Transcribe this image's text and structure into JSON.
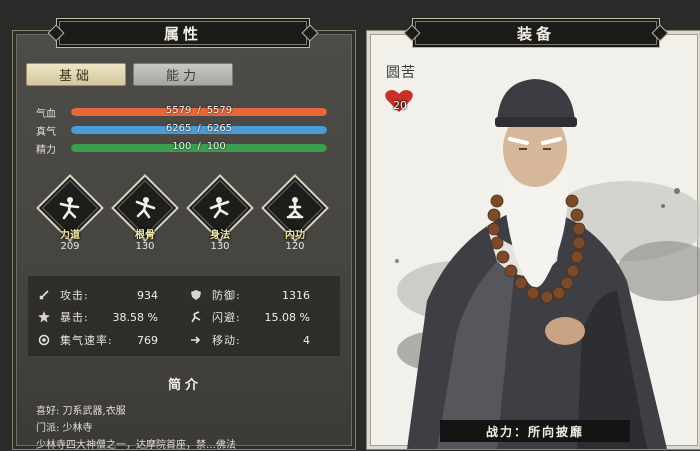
{
  "attributes_panel": {
    "title": "属性",
    "tabs": [
      {
        "label": "基础",
        "active": true
      },
      {
        "label": "能力",
        "active": false
      }
    ],
    "bars": [
      {
        "label": "气血",
        "current": "5579",
        "max": "5579",
        "fill_fraction": 1.0,
        "color": "#e8673a"
      },
      {
        "label": "真气",
        "current": "6265",
        "max": "6265",
        "fill_fraction": 1.0,
        "color": "#4a9cd6"
      },
      {
        "label": "精力",
        "current": "100",
        "max": "100",
        "fill_fraction": 1.0,
        "color": "#3a9e4e"
      }
    ],
    "bar_separator": "/",
    "attributes": [
      {
        "name": "力道",
        "value": "209",
        "icon": "strength-figure-icon"
      },
      {
        "name": "根骨",
        "value": "130",
        "icon": "constitution-figure-icon"
      },
      {
        "name": "身法",
        "value": "130",
        "icon": "agility-figure-icon"
      },
      {
        "name": "内功",
        "value": "120",
        "icon": "inner-power-figure-icon"
      }
    ],
    "stats": [
      {
        "label": "攻击:",
        "value": "934",
        "icon": "sword-icon"
      },
      {
        "label": "防御:",
        "value": "1316",
        "icon": "shield-icon"
      },
      {
        "label": "暴击:",
        "value": "38.58 %",
        "icon": "crit-burst-icon"
      },
      {
        "label": "闪避:",
        "value": "15.08 %",
        "icon": "dodge-icon"
      },
      {
        "label": "集气速率:",
        "value": "769",
        "icon": "charge-rate-icon"
      },
      {
        "label": "移动:",
        "value": "4",
        "icon": "move-icon"
      }
    ],
    "intro": {
      "title": "简介",
      "lines": [
        "喜好: 刀系武器,衣服",
        "门派: 少林寺",
        "少林寺四大神僧之一，达摩院首座，禁…佛法"
      ]
    }
  },
  "equipment_panel": {
    "title": "装备",
    "character_name": "圆苦",
    "favor_value": "20",
    "combat_power": "战力：所向披靡",
    "portrait": "elderly-monk-portrait"
  }
}
